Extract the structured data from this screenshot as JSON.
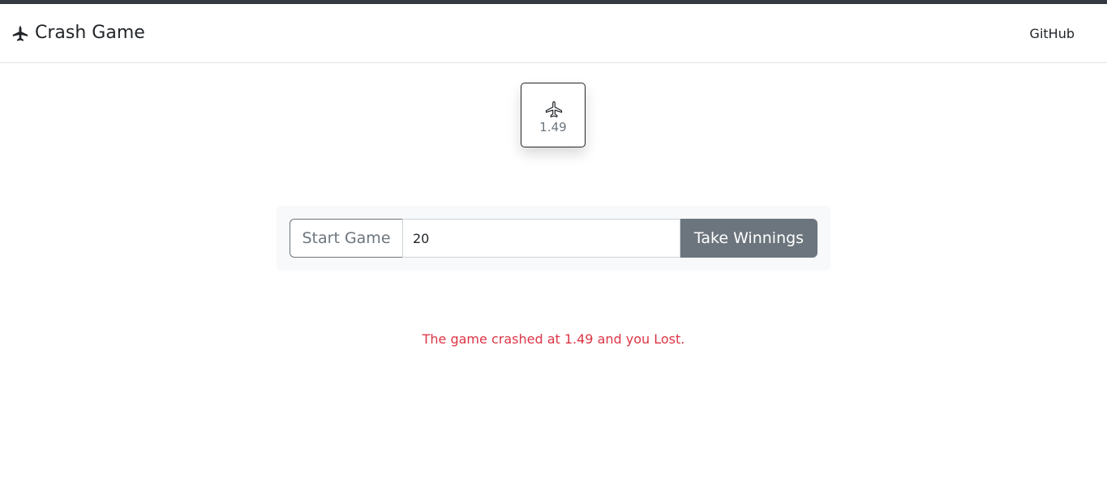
{
  "navbar": {
    "brand_icon": "fighter-jet-icon",
    "brand_title": "Crash Game",
    "github_link": "GitHub"
  },
  "game": {
    "card_icon": "airplane-icon",
    "multiplier": "1.49"
  },
  "controls": {
    "start_label": "Start Game",
    "bet_value": "20",
    "take_label": "Take Winnings"
  },
  "result": {
    "message": "The game crashed at 1.49 and you Lost."
  },
  "colors": {
    "top_strip": "#343a40",
    "danger_text": "#dc3545",
    "secondary": "#6c757d",
    "panel_bg": "#f8f9fa"
  }
}
